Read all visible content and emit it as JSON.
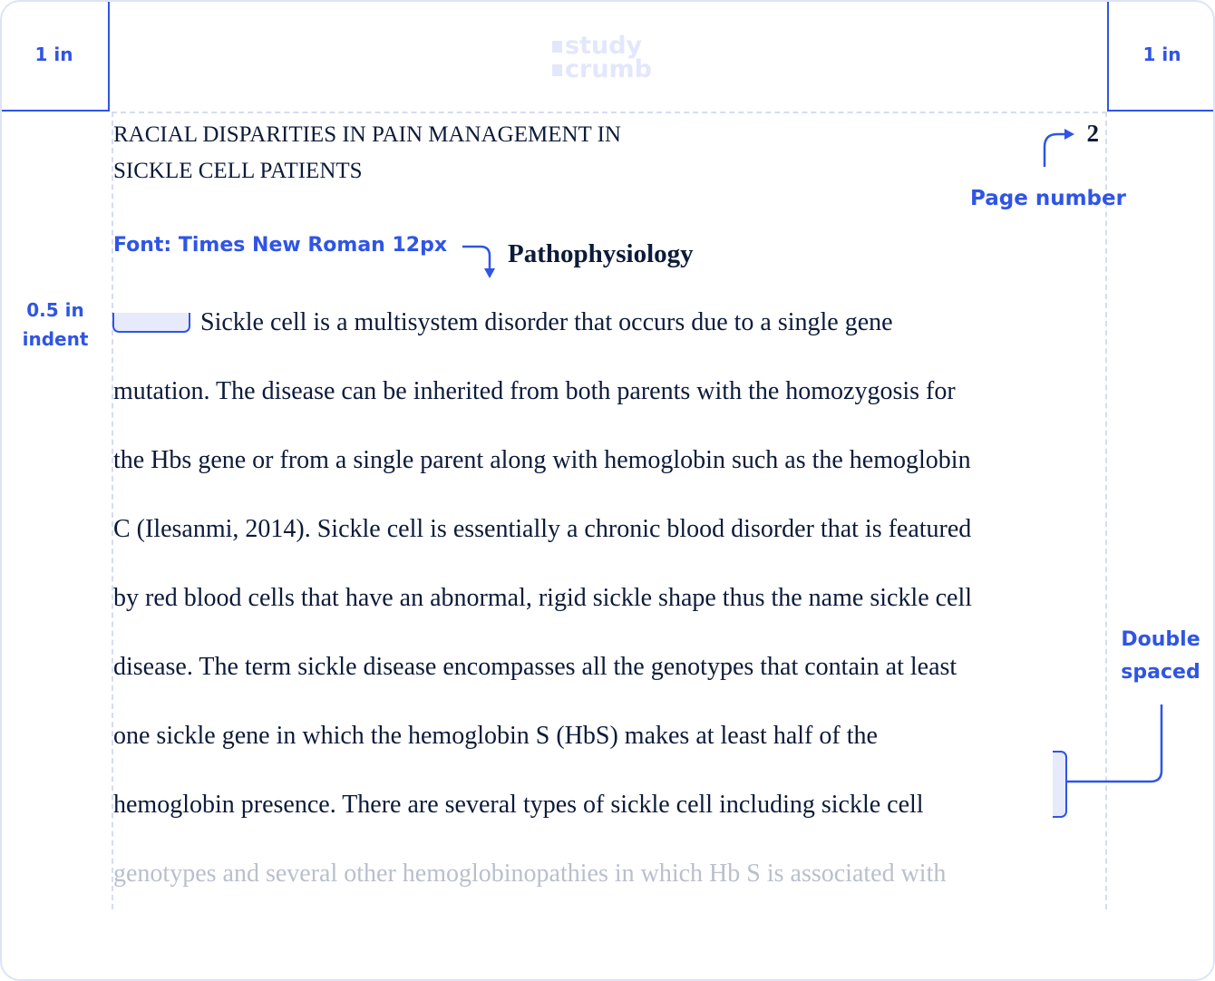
{
  "brand": {
    "logo_line1": "study",
    "logo_line2": "crumb"
  },
  "annotations": {
    "margin_left": "1 in",
    "margin_right": "1 in",
    "page_number_label": "Page number",
    "font_label": "Font: Times New Roman 12px",
    "indent_line1": "0.5 in",
    "indent_line2": "indent",
    "spacing_line1": "Double",
    "spacing_line2": "spaced"
  },
  "document": {
    "running_head_line1": "RACIAL DISPARITIES IN PAIN MANAGEMENT IN",
    "running_head_line2": "SICKLE CELL PATIENTS",
    "page_number": "2",
    "heading": "Pathophysiology",
    "body_lines": [
      "Sickle cell is a multisystem disorder that occurs due to a single gene",
      "mutation. The disease can be inherited from both parents with the homozygosis for",
      "the Hbs gene or from a single parent along with hemoglobin such as the hemoglobin",
      "C (Ilesanmi, 2014). Sickle cell is essentially a chronic blood disorder that is featured",
      "by red blood cells that have an abnormal, rigid sickle shape thus the name sickle cell",
      "disease.  The term sickle disease encompasses all the genotypes that contain at least",
      "one sickle gene in which the hemoglobin S (HbS) makes at least half of the",
      "hemoglobin presence. There are several types of sickle cell including sickle cell",
      "genotypes and several other hemoglobinopathies in which Hb S is associated with"
    ]
  },
  "colors": {
    "accent": "#2f55e4",
    "guide": "#d6dcf3",
    "text": "#0c1b3a",
    "faded_text": "#b9bfcc",
    "highlight": "#e6eafb"
  }
}
